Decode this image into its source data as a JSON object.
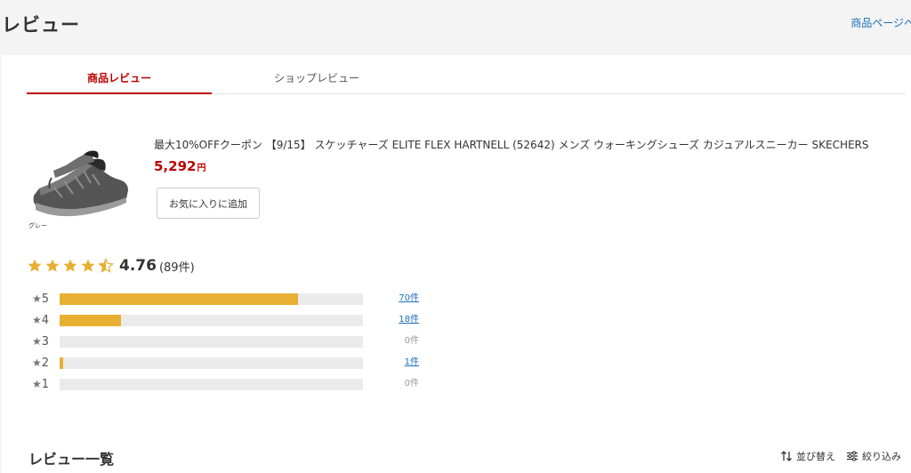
{
  "header": {
    "title": "レビュー",
    "product_page_link": "商品ページへ"
  },
  "tabs": [
    {
      "label": "商品レビュー",
      "active": true
    },
    {
      "label": "ショップレビュー",
      "active": false
    }
  ],
  "product": {
    "name": "最大10%OFFクーポン 【9/15】 スケッチャーズ ELITE FLEX HARTNELL (52642) メンズ ウォーキングシューズ カジュアルスニーカー SKECHERS",
    "price": "5,292",
    "currency": "円",
    "variant": "グレー",
    "favorite_button": "お気に入りに追加",
    "image_icon": "sneaker-image"
  },
  "rating": {
    "average": "4.76",
    "count_label": "(89件)",
    "stars_value": 4.76,
    "star_color": "#e8b032"
  },
  "distribution": [
    {
      "label": "5",
      "count_label": "70件",
      "fraction": 0.787,
      "linked": true
    },
    {
      "label": "4",
      "count_label": "18件",
      "fraction": 0.202,
      "linked": true
    },
    {
      "label": "3",
      "count_label": "0件",
      "fraction": 0,
      "linked": false
    },
    {
      "label": "2",
      "count_label": "1件",
      "fraction": 0.011,
      "linked": true
    },
    {
      "label": "1",
      "count_label": "0件",
      "fraction": 0,
      "linked": false
    }
  ],
  "review_list": {
    "title": "レビュー一覧",
    "sort_label": "並び替え",
    "filter_label": "絞り込み"
  },
  "colors": {
    "accent": "#bf0000",
    "link": "#1a70b8",
    "bar": "#e8b032",
    "track": "#ebebeb"
  }
}
